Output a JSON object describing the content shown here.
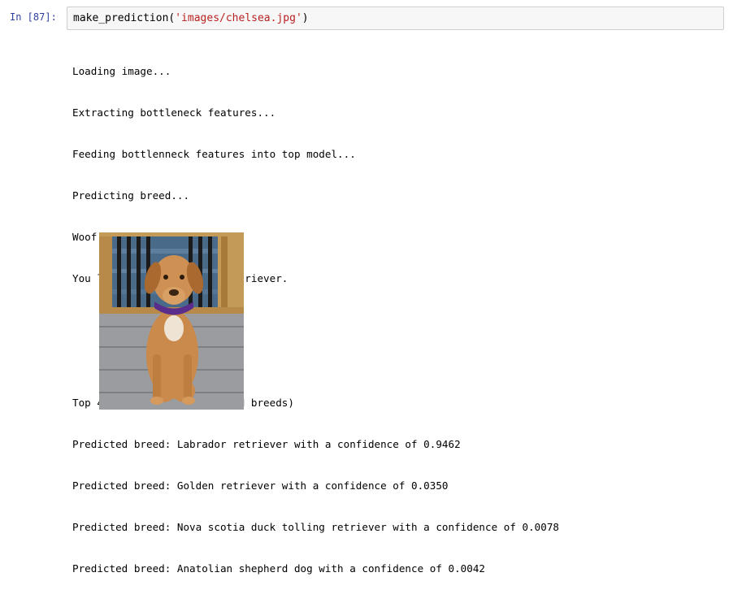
{
  "cell": {
    "prompt": "In [87]:",
    "code_fn": "make_prediction(",
    "code_arg": "'images/chelsea.jpg'",
    "code_close": ")"
  },
  "output": {
    "lines": [
      "Loading image...",
      "Extracting bottleneck features...",
      "Feeding bottlenneck features into top model...",
      "Predicting breed...",
      "Woof woof!",
      "You look like a Labrador retriever."
    ],
    "predictions_header": "Top 4 predictions (for mixed breeds)",
    "predictions": [
      "Predicted breed: Labrador retriever with a confidence of 0.9462",
      "Predicted breed: Golden retriever with a confidence of 0.0350",
      "Predicted breed: Nova scotia duck tolling retriever with a confidence of 0.0078",
      "Predicted breed: Anatolian shepherd dog with a confidence of 0.0042"
    ]
  },
  "colors": {
    "prompt": "#303f9f",
    "string": "#ba2121",
    "input_bg": "#f7f7f7",
    "input_border": "#cfcfcf"
  }
}
